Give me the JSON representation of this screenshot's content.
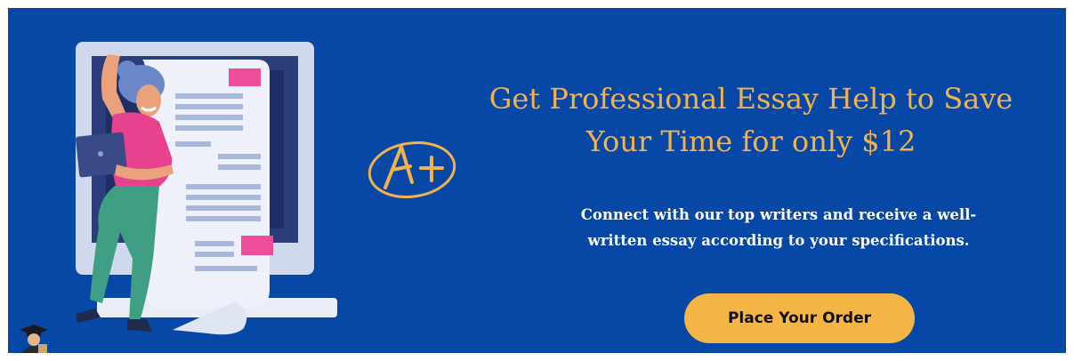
{
  "banner": {
    "background_color": "#0747a6",
    "accent_color": "#f3b24c",
    "headline_line1": "Get Professional Essay Help to Save",
    "headline_line2": "Your Time for only $12",
    "subtext_line1": "Connect with our top writers and receive a well-",
    "subtext_line2": "written essay according to your specifications.",
    "cta_label": "Place Your Order",
    "grade_icon": "a-plus-grade-icon",
    "illustration": "woman-with-laptop-and-document-illustration",
    "avatar_icon": "graduate-avatar-icon"
  }
}
